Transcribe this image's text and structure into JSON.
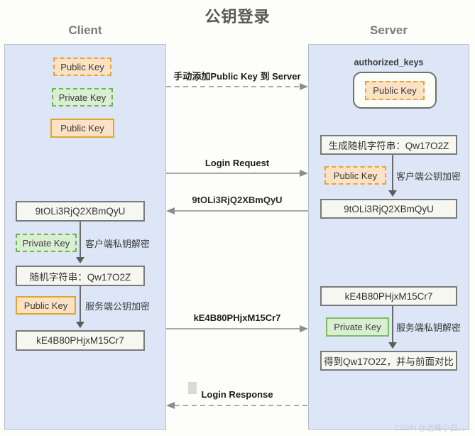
{
  "title": "公钥登录",
  "columns": {
    "client": "Client",
    "server": "Server"
  },
  "client": {
    "keys": [
      {
        "label": "Public Key",
        "style": "public-dashed"
      },
      {
        "label": "Private Key",
        "style": "private-dashed"
      },
      {
        "label": "Public Key",
        "style": "public-solid"
      }
    ],
    "steps": [
      {
        "box": "9tOLi3RjQ2XBmQyU"
      },
      {
        "chip": "Private Key",
        "chip_style": "private-dashed",
        "note": "客户端私钥解密"
      },
      {
        "box": "随机字符串：Qw17O2Z"
      },
      {
        "chip": "Public Key",
        "chip_style": "public-solid",
        "note": "服务端公钥加密"
      },
      {
        "box": "kE4B80PHjxM15Cr7"
      }
    ]
  },
  "server": {
    "authorized_keys_label": "authorized_keys",
    "authorized_keys_chip": "Public Key",
    "steps": [
      {
        "box": "生成随机字符串：Qw17O2Z"
      },
      {
        "chip": "Public Key",
        "chip_style": "public-dashed",
        "note": "客户端公钥加密"
      },
      {
        "box": "9tOLi3RjQ2XBmQyU"
      },
      {
        "box2": "kE4B80PHjxM15Cr7"
      },
      {
        "chip": "Private Key",
        "chip_style": "private-solid",
        "note": "服务端私钥解密"
      },
      {
        "box3": "得到Qw17O2Z，并与前面对比"
      }
    ]
  },
  "flows": [
    {
      "label": "手动添加Public Key 到 Server",
      "direction": "right",
      "style": "dashed"
    },
    {
      "label": "Login Request",
      "direction": "right",
      "style": "solid"
    },
    {
      "label": "9tOLi3RjQ2XBmQyU",
      "direction": "left",
      "style": "solid"
    },
    {
      "label": "kE4B80PHjxM15Cr7",
      "direction": "right",
      "style": "solid"
    },
    {
      "label": "Login Response",
      "direction": "left",
      "style": "dashed"
    }
  ],
  "watermark": "CSDN @运维小白。。",
  "colors": {
    "panel_bg": "#dce6f6",
    "public_key_bg": "#fbe2c4",
    "public_key_border": "#e0a62e",
    "private_key_bg": "#d9eed2",
    "private_key_border": "#7cbd60",
    "box_border": "#7a7a7a",
    "title_text": "#595959"
  }
}
